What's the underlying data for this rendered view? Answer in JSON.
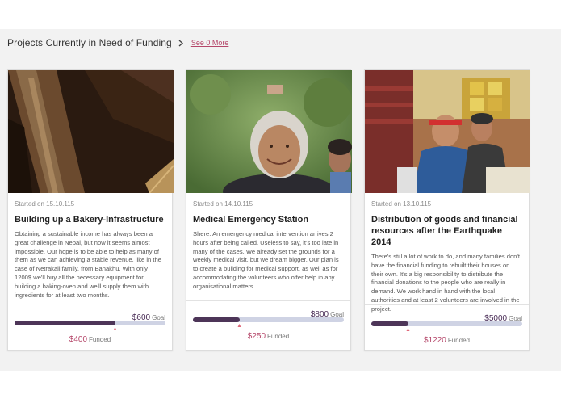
{
  "section": {
    "title": "Projects Currently in Need of Funding",
    "see_more": "See 0 More",
    "chevron_icon": "chevron-right-icon"
  },
  "colors": {
    "accent": "#b5476a",
    "progress_fill": "#4d3558",
    "progress_track": "#cfd3e4",
    "marker": "#e06a7b",
    "background": "#f2f2f2"
  },
  "projects": [
    {
      "image": "wood-beams-photo",
      "started": "Started on 15.10.115",
      "title": "Building up a Bakery-Infrastructure",
      "description": "Obtaining a sustainable income has always been a great challenge in Nepal, but now it seems almost impossible. Our hope is to be able to help as many of them as we can achieving a stable revenue, like in the case of Netrakali family, from Banakhu. With only 1200$ we'll buy all the necessary equipment for building a baking-oven and we'll supply them with ingredients for at least two months.",
      "goal": "$600",
      "goal_label": "Goal",
      "funded": "$400",
      "funded_label": "Funded",
      "progress": 0.667
    },
    {
      "image": "smiling-elder-woman-photo",
      "started": "Started on 14.10.115",
      "title": "Medical Emergency Station",
      "description": "Shere. An emergency medical intervention arrives 2 hours after being called. Useless to say, it's too late in many of the cases. We already set the grounds for a weekly medical visit, but we dream bigger. Our plan is to create a building for medical support, as well as for accommodating the volunteers who offer help in any organisational matters.",
      "goal": "$800",
      "goal_label": "Goal",
      "funded": "$250",
      "funded_label": "Funded",
      "progress": 0.3125
    },
    {
      "image": "goods-distribution-photo",
      "started": "Started on 13.10.115",
      "title": "Distribution of goods and financial resources after the Earthquake 2014",
      "description": "There's still a lot of work to do, and many families don't have the financial funding to rebuilt their houses on their own. It's a big responsibility to distribute the financial donations to the people who are really in demand. We work hand in hand with the local authorities and at least 2 volunteers are involved in the project.",
      "goal": "$5000",
      "goal_label": "Goal",
      "funded": "$1220",
      "funded_label": "Funded",
      "progress": 0.244
    }
  ]
}
